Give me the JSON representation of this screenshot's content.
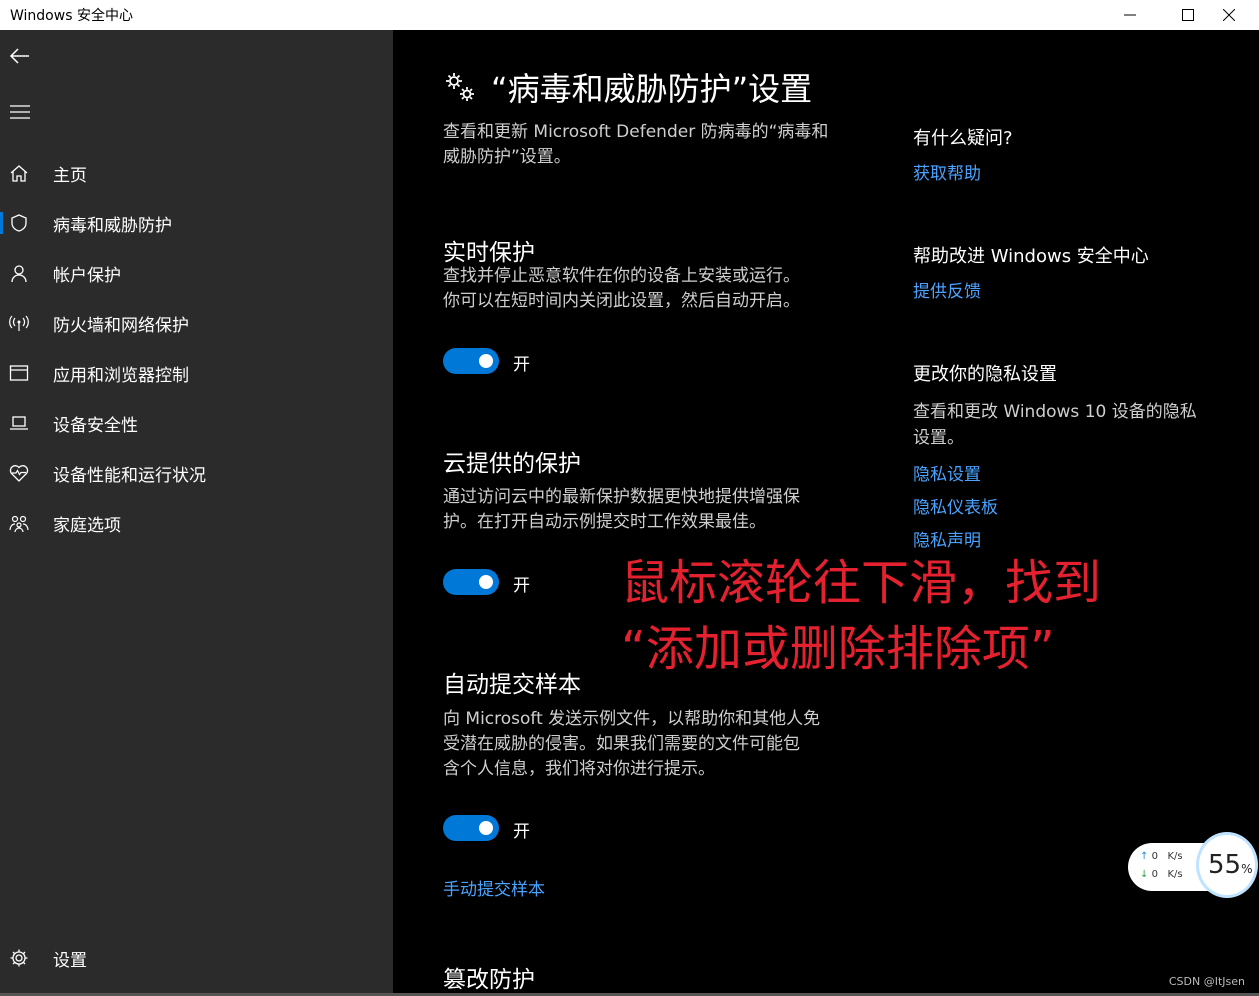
{
  "window": {
    "title": "Windows 安全中心"
  },
  "sidebar": {
    "items": [
      {
        "label": "主页",
        "icon": "home-icon"
      },
      {
        "label": "病毒和威胁防护",
        "icon": "shield-icon",
        "active": true
      },
      {
        "label": "帐户保护",
        "icon": "person-icon"
      },
      {
        "label": "防火墙和网络保护",
        "icon": "wifi-antenna-icon"
      },
      {
        "label": "应用和浏览器控制",
        "icon": "browser-window-icon"
      },
      {
        "label": "设备安全性",
        "icon": "laptop-icon"
      },
      {
        "label": "设备性能和运行状况",
        "icon": "heart-pulse-icon"
      },
      {
        "label": "家庭选项",
        "icon": "family-icon"
      }
    ],
    "settings_label": "设置"
  },
  "main": {
    "title": "“病毒和威胁防护”设置",
    "intro_line1": "查看和更新 Microsoft Defender 防病毒的“病毒和",
    "intro_line2": "威胁防护”设置。",
    "sections": [
      {
        "title": "实时保护",
        "desc1": "查找并停止恶意软件在你的设备上安装或运行。",
        "desc2": "你可以在短时间内关闭此设置，然后自动开启。",
        "toggle_label": "开",
        "toggle_on": true
      },
      {
        "title": "云提供的保护",
        "desc1": "通过访问云中的最新保护数据更快地提供增强保",
        "desc2": "护。在打开自动示例提交时工作效果最佳。",
        "toggle_label": "开",
        "toggle_on": true
      },
      {
        "title": "自动提交样本",
        "desc1": "向 Microsoft 发送示例文件，以帮助你和其他人免",
        "desc2": "受潜在威胁的侵害。如果我们需要的文件可能包",
        "desc3": "含个人信息，我们将对你进行提示。",
        "toggle_label": "开",
        "toggle_on": true,
        "link": "手动提交样本"
      },
      {
        "title": "篡改防护"
      }
    ]
  },
  "right": {
    "q_title": "有什么疑问?",
    "help_link": "获取帮助",
    "improve_title": "帮助改进 Windows 安全中心",
    "feedback_link": "提供反馈",
    "privacy_title": "更改你的隐私设置",
    "privacy_desc1": "查看和更改 Windows 10 设备的隐私",
    "privacy_desc2": "设置。",
    "privacy_links": [
      "隐私设置",
      "隐私仪表板",
      "隐私声明"
    ]
  },
  "annotation": {
    "line1": "鼠标滚轮往下滑，找到",
    "line2": "“添加或删除排除项”"
  },
  "net_widget": {
    "up_value": "0",
    "up_unit": "K/s",
    "down_value": "0",
    "down_unit": "K/s",
    "percent": "55",
    "percent_sign": "%"
  },
  "watermark": "CSDN @ItJsen",
  "colors": {
    "accent": "#0078d7",
    "link": "#4aa3ff",
    "annotation": "#e4212f",
    "sidebar_bg": "#2b2b2b"
  }
}
